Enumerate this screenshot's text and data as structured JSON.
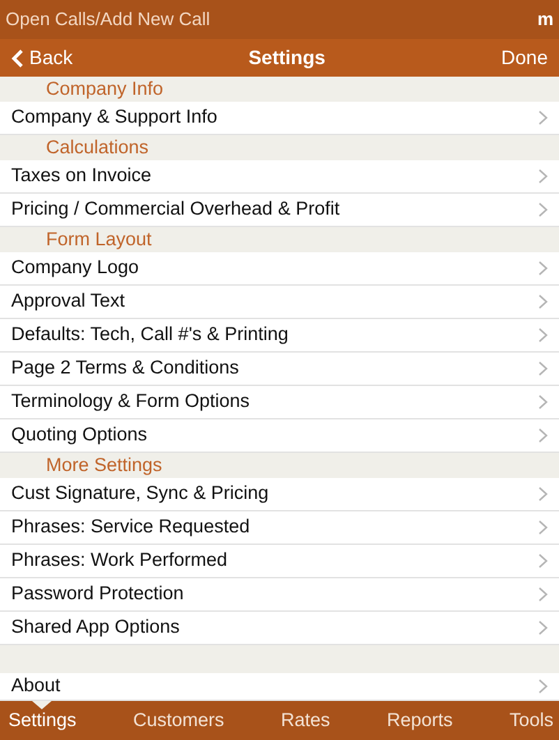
{
  "status_bar": {
    "left": "Open Calls/Add New Call",
    "right": "m"
  },
  "nav": {
    "back": "Back",
    "title": "Settings",
    "done": "Done"
  },
  "sections": [
    {
      "header": "Company Info",
      "items": [
        {
          "label": "Company & Support Info"
        }
      ]
    },
    {
      "header": "Calculations",
      "items": [
        {
          "label": "Taxes on Invoice"
        },
        {
          "label": "Pricing / Commercial Overhead & Profit"
        }
      ]
    },
    {
      "header": "Form Layout",
      "items": [
        {
          "label": "Company Logo"
        },
        {
          "label": "Approval Text"
        },
        {
          "label": "Defaults: Tech, Call #'s & Printing"
        },
        {
          "label": "Page 2 Terms & Conditions"
        },
        {
          "label": "Terminology & Form Options"
        },
        {
          "label": "Quoting Options"
        }
      ]
    },
    {
      "header": "More Settings",
      "items": [
        {
          "label": "Cust Signature, Sync & Pricing"
        },
        {
          "label": "Phrases: Service Requested"
        },
        {
          "label": "Phrases: Work Performed"
        },
        {
          "label": "Password Protection"
        },
        {
          "label": "Shared App Options"
        }
      ]
    },
    {
      "items": [
        {
          "label": "About"
        }
      ]
    }
  ],
  "tabs": [
    {
      "label": "Settings",
      "selected": true
    },
    {
      "label": "Customers",
      "selected": false
    },
    {
      "label": "Rates",
      "selected": false
    },
    {
      "label": "Reports",
      "selected": false
    },
    {
      "label": "Tools",
      "selected": false
    }
  ]
}
